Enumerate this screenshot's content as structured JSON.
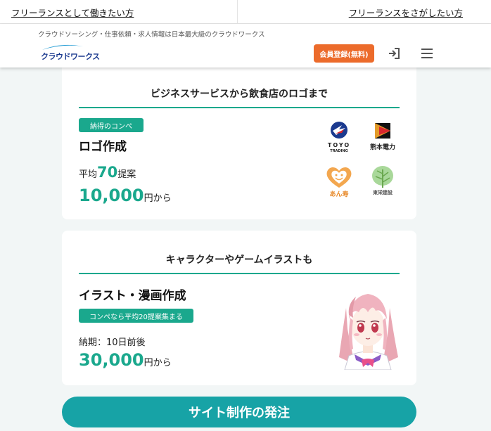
{
  "audience_nav": {
    "freelancer_link": "フリーランスとして働きたい方",
    "client_link": "フリーランスをさがしたい方"
  },
  "header": {
    "tagline": "クラウドソーシング・仕事依頼・求人情報は日本最大級のクラウドワークス",
    "logo_text": "クラウドワークス",
    "register_button": "会員登録(無料)",
    "login_icon": "login-icon",
    "menu_icon": "hamburger-menu-icon"
  },
  "logo_service": {
    "heading": "ビジネスサービスから飲食店のロゴまで",
    "badge": "納得のコンペ",
    "title": "ロゴ作成",
    "avg_prefix": "平均",
    "avg_num": "70",
    "avg_suffix": "提案",
    "price_num": "10,000",
    "price_suffix": "円から",
    "example_logos": {
      "toyo": "TOYO",
      "toyo_sub": "TRADING",
      "kumamoto": "熊本電力",
      "anju": "あん寿",
      "toei": "東栄建設"
    }
  },
  "illust_service": {
    "heading": "キャラクターやゲームイラストも",
    "title": "イラスト・漫画作成",
    "badge": "コンペなら平均20提案集まる",
    "deadline": "納期：10日前後",
    "price_num": "30,000",
    "price_suffix": "円から"
  },
  "cta": {
    "label": "サイト制作の発注"
  },
  "colors": {
    "accent_green": "#1aa88d",
    "cta_teal": "#17a3a6",
    "register_orange": "#ec6b2b",
    "brand_navy": "#1b3a8f"
  }
}
